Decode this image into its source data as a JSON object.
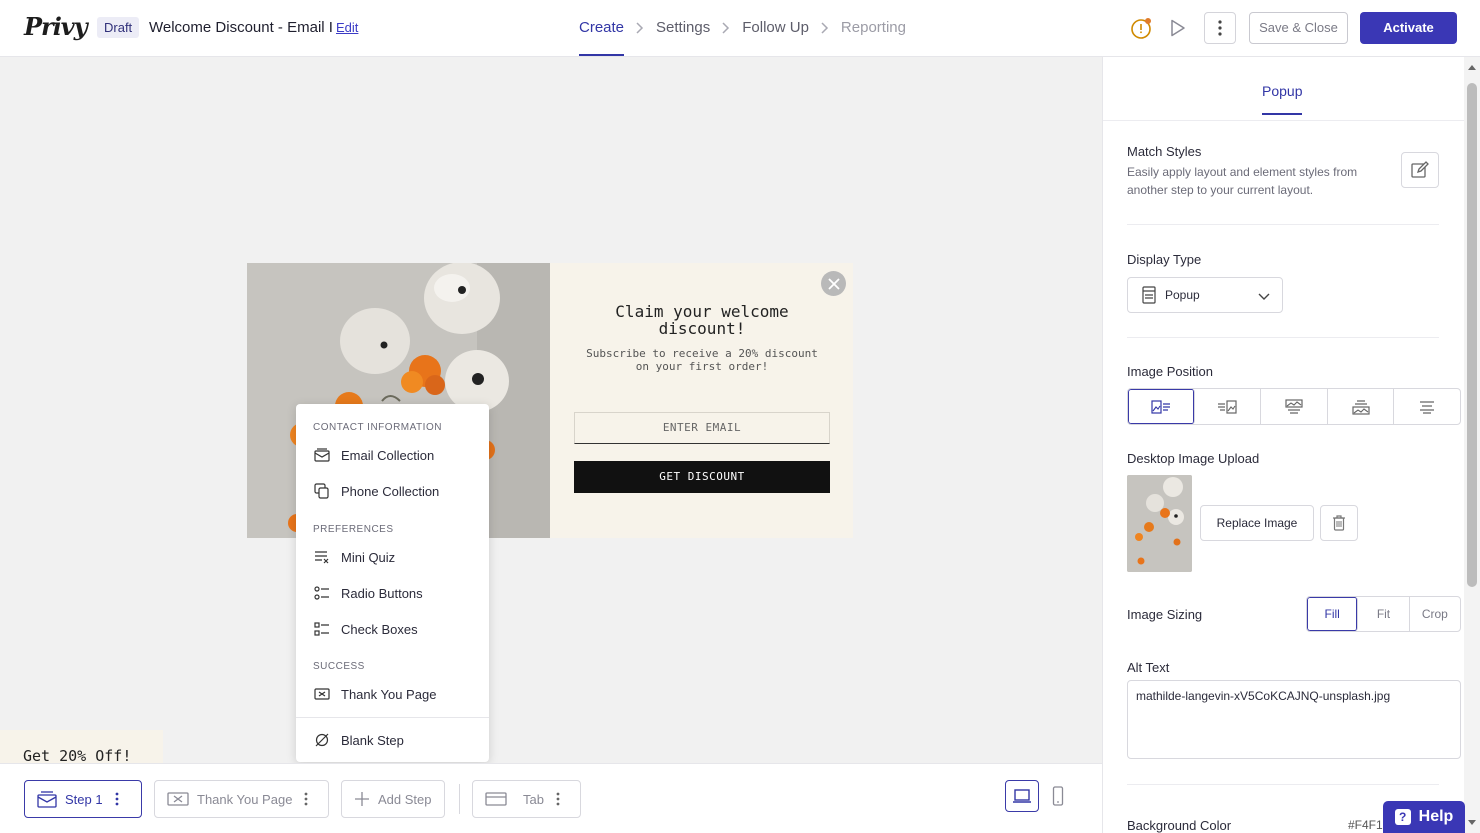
{
  "header": {
    "logo": "Privy",
    "status_badge": "Draft",
    "campaign_title": "Welcome Discount - Email I",
    "edit_label": "Edit",
    "steps": [
      {
        "label": "Create",
        "state": "active"
      },
      {
        "label": "Settings",
        "state": "normal"
      },
      {
        "label": "Follow Up",
        "state": "normal"
      },
      {
        "label": "Reporting",
        "state": "muted"
      }
    ],
    "save_close_label": "Save & Close",
    "activate_label": "Activate"
  },
  "popup": {
    "headline": "Claim your welcome discount!",
    "subtext": "Subscribe to receive a 20% discount on your first order!",
    "email_placeholder": "ENTER EMAIL",
    "cta_label": "GET DISCOUNT"
  },
  "step_menu": {
    "sections": [
      {
        "title": "CONTACT INFORMATION",
        "items": [
          "Email Collection",
          "Phone Collection"
        ]
      },
      {
        "title": "PREFERENCES",
        "items": [
          "Mini Quiz",
          "Radio Buttons",
          "Check Boxes"
        ]
      },
      {
        "title": "SUCCESS",
        "items": [
          "Thank You Page"
        ]
      }
    ],
    "blank_step": "Blank Step"
  },
  "teaser_text": "Get 20% Off!",
  "bottom_bar": {
    "step1": "Step 1",
    "thank_you": "Thank You Page",
    "add_step": "Add Step",
    "tab": "Tab"
  },
  "panel": {
    "tab_label": "Popup",
    "match_styles": {
      "label": "Match Styles",
      "description": "Easily apply layout and element styles from another step to your current layout."
    },
    "display_type": {
      "label": "Display Type",
      "value": "Popup"
    },
    "image_position_label": "Image Position",
    "desktop_image_label": "Desktop Image Upload",
    "replace_image_label": "Replace Image",
    "image_sizing": {
      "label": "Image Sizing",
      "options": [
        "Fill",
        "Fit",
        "Crop"
      ],
      "selected": "Fill"
    },
    "alt_text": {
      "label": "Alt Text",
      "value": "mathilde-langevin-xV5CoKCAJNQ-unsplash.jpg"
    },
    "background_color": {
      "label": "Background Color",
      "value": "#F4F1"
    }
  },
  "help_label": "Help",
  "colors": {
    "accent": "#3a37b5",
    "popup_background": "#f7f3ea",
    "canvas": "#f1f1f1"
  }
}
